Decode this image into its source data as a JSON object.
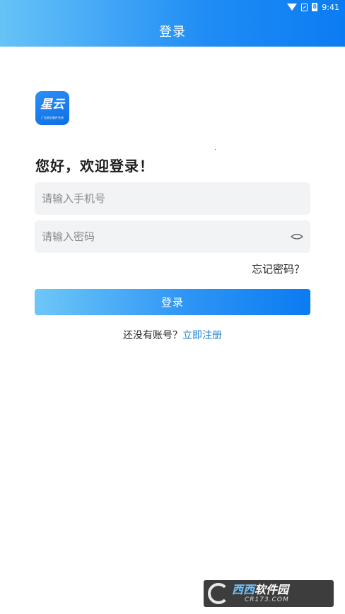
{
  "status_bar": {
    "time": "9:41",
    "battery_label": "8",
    "icons": [
      "wifi-icon",
      "sim-icon",
      "battery-icon"
    ]
  },
  "header": {
    "title": "登录"
  },
  "logo": {
    "text": "星云",
    "subtext": "广告星机事件系统"
  },
  "greeting": "您好，欢迎登录！",
  "phone_field": {
    "placeholder": "请输入手机号",
    "value": ""
  },
  "password_field": {
    "placeholder": "请输入密码",
    "value": "",
    "toggle_icon": "eye-closed-icon"
  },
  "forgot_password": "忘记密码？",
  "login_button": "登录",
  "register": {
    "prompt": "还没有账号？",
    "link": "立即注册"
  },
  "watermark": {
    "brand_part1": "西西",
    "brand_part2": "软件园",
    "domain": "CR173.COM"
  },
  "colors": {
    "header_gradient_start": "#67c3f7",
    "header_gradient_end": "#0b7cf2",
    "link": "#1a7fd6",
    "field_bg": "#f2f3f5"
  }
}
